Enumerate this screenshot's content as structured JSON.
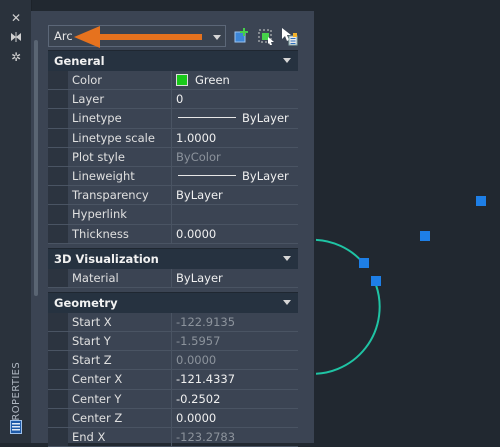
{
  "palette": {
    "vertical_title": "PROPERTIES",
    "selector_value": "Arc",
    "title_icons": [
      "close-icon",
      "auto-hide-icon",
      "settings-icon"
    ],
    "toolbar_icons": [
      "toggle-pickadd-icon",
      "select-objects-icon",
      "quick-select-icon"
    ]
  },
  "sections": [
    {
      "title": "General",
      "rows": [
        {
          "name": "Color",
          "value": "Green",
          "kind": "color",
          "color": "#19c81a"
        },
        {
          "name": "Layer",
          "value": "0"
        },
        {
          "name": "Linetype",
          "value": "ByLayer",
          "kind": "line"
        },
        {
          "name": "Linetype scale",
          "value": "1.0000"
        },
        {
          "name": "Plot style",
          "value": "ByColor",
          "dim": true
        },
        {
          "name": "Lineweight",
          "value": "ByLayer",
          "kind": "line"
        },
        {
          "name": "Transparency",
          "value": "ByLayer"
        },
        {
          "name": "Hyperlink",
          "value": ""
        },
        {
          "name": "Thickness",
          "value": "0.0000"
        }
      ]
    },
    {
      "title": "3D Visualization",
      "rows": [
        {
          "name": "Material",
          "value": "ByLayer"
        }
      ]
    },
    {
      "title": "Geometry",
      "rows": [
        {
          "name": "Start X",
          "value": "-122.9135",
          "dim": true
        },
        {
          "name": "Start Y",
          "value": "-1.5957",
          "dim": true
        },
        {
          "name": "Start Z",
          "value": "0.0000",
          "dim": true
        },
        {
          "name": "Center X",
          "value": "-121.4337"
        },
        {
          "name": "Center Y",
          "value": "-0.2502"
        },
        {
          "name": "Center Z",
          "value": "0.0000"
        },
        {
          "name": "End X",
          "value": "-123.2783",
          "dim": true
        }
      ]
    }
  ],
  "colors": {
    "arc": "#1fc4a4",
    "grip": "#1e7fe6",
    "callout_arrow": "#e6721e"
  }
}
